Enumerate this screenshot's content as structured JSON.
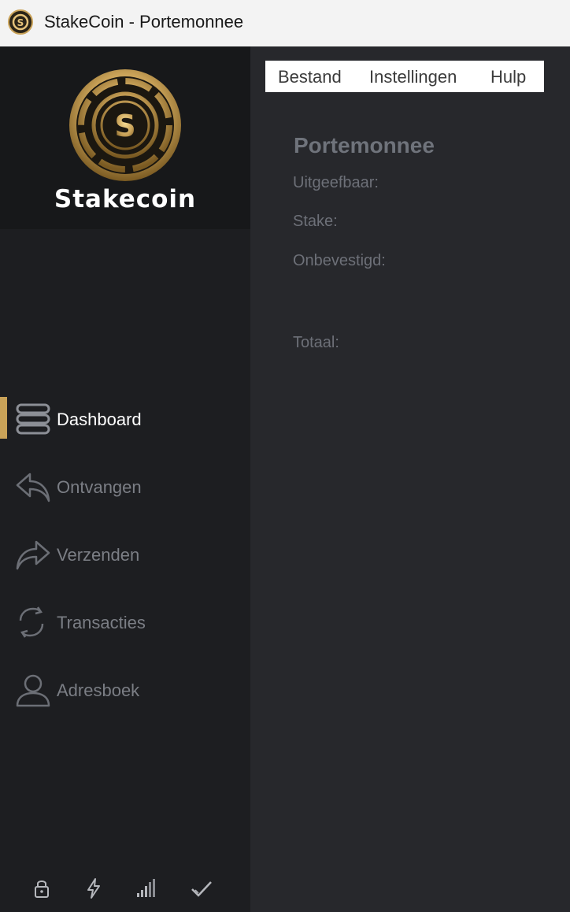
{
  "window": {
    "title": "StakeCoin - Portemonnee"
  },
  "sidebar": {
    "logo_text": "Stakecoin",
    "items": [
      {
        "label": "Dashboard",
        "icon": "dashboard-stack-icon",
        "active": true
      },
      {
        "label": "Ontvangen",
        "icon": "reply-arrow-icon"
      },
      {
        "label": "Verzenden",
        "icon": "forward-arrow-icon"
      },
      {
        "label": "Transacties",
        "icon": "sync-arrows-icon"
      },
      {
        "label": "Adresboek",
        "icon": "user-icon"
      }
    ],
    "status_icons": [
      "lock-icon",
      "lightning-icon",
      "signal-bars-icon",
      "check-icon"
    ]
  },
  "menu": {
    "items": [
      "Bestand",
      "Instellingen",
      "Hulp"
    ]
  },
  "wallet": {
    "heading": "Portemonnee",
    "spendable_label": "Uitgeefbaar:",
    "stake_label": "Stake:",
    "unconfirmed_label": "Onbevestigd:",
    "total_label": "Totaal:"
  },
  "colors": {
    "accent": "#c9a258",
    "sidebar_bg": "#1d1e21",
    "main_bg": "#27282c"
  }
}
